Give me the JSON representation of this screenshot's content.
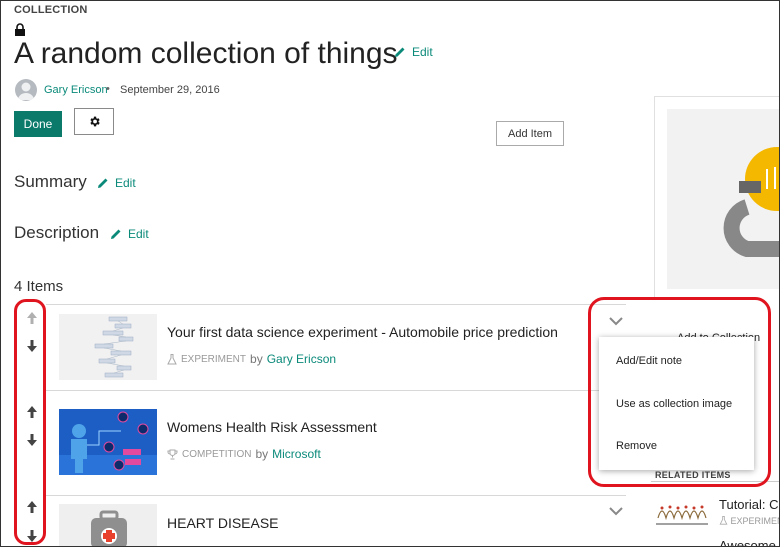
{
  "header": {
    "label": "COLLECTION",
    "title": "A random collection of things",
    "edit_label": "Edit",
    "author": "Gary Ericson",
    "separator": "•",
    "date": "September 29, 2016"
  },
  "toolbar": {
    "done_label": "Done",
    "add_item_label": "Add Item"
  },
  "sections": {
    "summary_label": "Summary",
    "description_label": "Description",
    "edit_label": "Edit"
  },
  "items_count": "4 Items",
  "items": [
    {
      "title": "Your first data science experiment - Automobile price prediction",
      "type": "EXPERIMENT",
      "by": "by",
      "owner": "Gary Ericson"
    },
    {
      "title": "Womens Health Risk Assessment",
      "type": "COMPETITION",
      "by": "by",
      "owner": "Microsoft"
    },
    {
      "title": "HEART DISEASE",
      "type": "",
      "by": "",
      "owner": ""
    }
  ],
  "context_menu": {
    "items": [
      "Add/Edit note",
      "Use as collection image",
      "Remove"
    ]
  },
  "sidebar": {
    "partial_label": "Add to Collection",
    "related_label": "RELATED ITEMS",
    "related_title": "Tutorial: Cr",
    "related_meta": "EXPERIMENT",
    "related_next": "Awesome"
  },
  "colors": {
    "accent": "#0b8a7a",
    "done_button": "#0b7a6b",
    "highlight": "#e0141e"
  }
}
